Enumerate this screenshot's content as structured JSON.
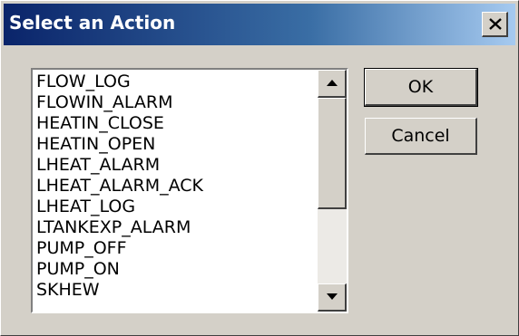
{
  "window": {
    "title": "Select an Action",
    "close_glyph": "✕"
  },
  "actions_list": {
    "items": [
      "FLOW_LOG",
      "FLOWIN_ALARM",
      "HEATIN_CLOSE",
      "HEATIN_OPEN",
      "LHEAT_ALARM",
      "LHEAT_ALARM_ACK",
      "LHEAT_LOG",
      "LTANKEXP_ALARM",
      "PUMP_OFF",
      "PUMP_ON",
      "SKHEW"
    ],
    "scroll_position": 0
  },
  "buttons": {
    "ok_label": "OK",
    "cancel_label": "Cancel"
  },
  "icons": {
    "close": "close-icon",
    "scroll_up": "arrow-up-icon",
    "scroll_down": "arrow-down-icon"
  }
}
